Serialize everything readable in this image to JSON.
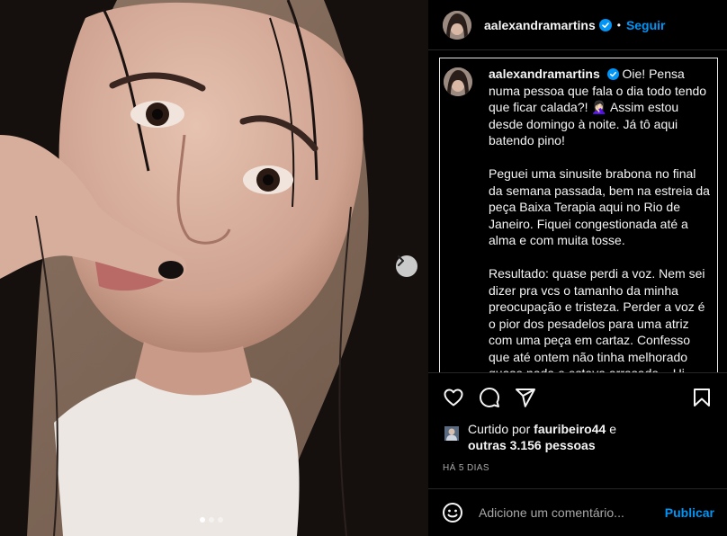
{
  "post": {
    "username": "aalexandramartins",
    "follow_label": "Seguir",
    "separator": "•",
    "caption": {
      "username": "aalexandramartins",
      "paragraphs": [
        "Oie! Pensa numa pessoa que fala o dia todo tendo que ficar calada?! 🤦🏻‍♀️ Assim estou desde domingo à noite. Já tô aqui batendo pino!",
        "Peguei uma sinusite brabona no final da semana passada, bem na estreia da peça Baixa Terapia aqui no Rio de Janeiro. Fiquei congestionada até a alma e com muita tosse.",
        "Resultado: quase perdi a voz. Nem sei dizer pra vcs o tamanho da minha preocupação e tristeza. Perder a voz é o pior dos pesadelos para uma atriz com uma peça em cartaz. Confesso que até ontem não tinha melhorado quase nada e estava arrasada... Hj"
      ]
    },
    "likes": {
      "prefix": "Curtido por",
      "user": "fauribeiro44",
      "connector": "e",
      "others": "outras 3.156 pessoas"
    },
    "time": "HÁ 5 DIAS",
    "comment": {
      "placeholder": "Adicione um comentário...",
      "publish_label": "Publicar"
    },
    "carousel": {
      "slides": 3,
      "active": 1
    }
  },
  "icons": [
    "verified-badge-icon",
    "next-chevron-icon",
    "heart-icon",
    "comment-icon",
    "share-icon",
    "bookmark-icon",
    "emoji-icon"
  ],
  "colors": {
    "accent": "#0095f6",
    "background": "#000000",
    "text": "#f5f5f5",
    "muted": "#a8a8a8"
  }
}
